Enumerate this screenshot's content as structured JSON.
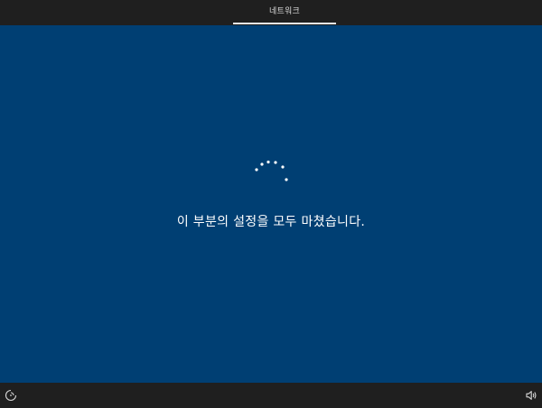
{
  "header": {
    "tabs": [
      {
        "label": "네트워크",
        "active": true
      }
    ]
  },
  "main": {
    "message": "이 부분의 설정을 모두 마쳤습니다."
  },
  "footer": {
    "left_icon": "ease-of-access-icon",
    "right_icon": "volume-icon"
  },
  "colors": {
    "background": "#003f73",
    "bars": "#1f1f1f",
    "text": "#ffffff"
  }
}
